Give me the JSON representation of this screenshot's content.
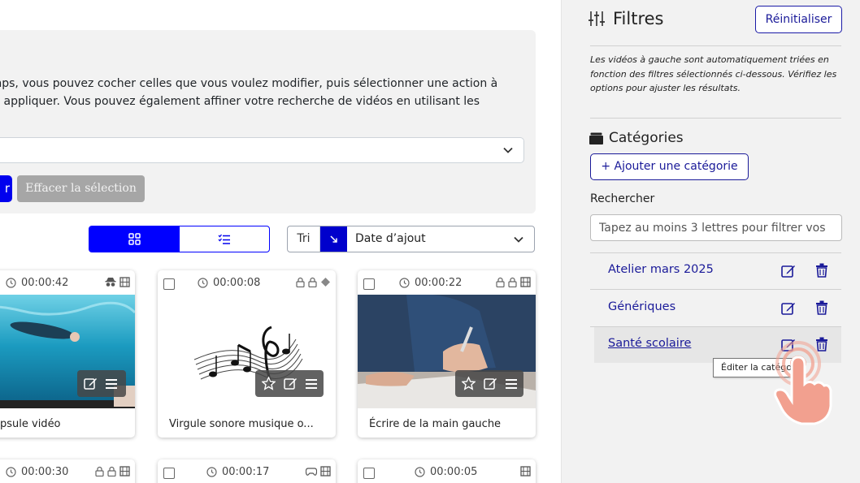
{
  "main": {
    "info_line1": "emps, vous pouvez cocher celles que vous voulez modifier, puis sélectionner une action à",
    "info_line2": "uis appliquer. Vous pouvez également affiner votre recherche de vidéos en utilisant les",
    "action_select_value": "",
    "apply_label": "r",
    "clear_selection_label": "Effacer la sélection",
    "sort_label": "Tri",
    "sort_value": "Date d’ajout"
  },
  "cards": [
    {
      "duration": "00:00:42",
      "title": "psule vidéo"
    },
    {
      "duration": "00:00:08",
      "title": "Virgule sonore musique o..."
    },
    {
      "duration": "00:00:22",
      "title": "Écrire de la main gauche"
    }
  ],
  "cards_row2": [
    {
      "duration": "00:00:30"
    },
    {
      "duration": "00:00:17"
    },
    {
      "duration": "00:00:05"
    }
  ],
  "sidebar": {
    "title": "Filtres",
    "reset_label": "Réinitialiser",
    "note": "Les vidéos à gauche sont automatiquement triées en fonction des filtres sélectionnés ci-dessous. Vérifiez les options pour ajuster les résultats.",
    "categories_title": "Catégories",
    "add_category_label": "+ Ajouter une catégorie",
    "search_label": "Rechercher",
    "search_placeholder": "Tapez au moins 3 lettres pour filtrer vos",
    "categories": [
      {
        "name": "Atelier mars 2025"
      },
      {
        "name": "Génériques"
      },
      {
        "name": "Santé scolaire"
      }
    ],
    "tooltip": "Éditer la catégorie"
  },
  "colors": {
    "primary": "#0000ff",
    "link": "#1a1a99",
    "panel_bg": "#f2f2f2",
    "disabled_btn": "#a6a6a6",
    "hand": "#f2a08f"
  }
}
